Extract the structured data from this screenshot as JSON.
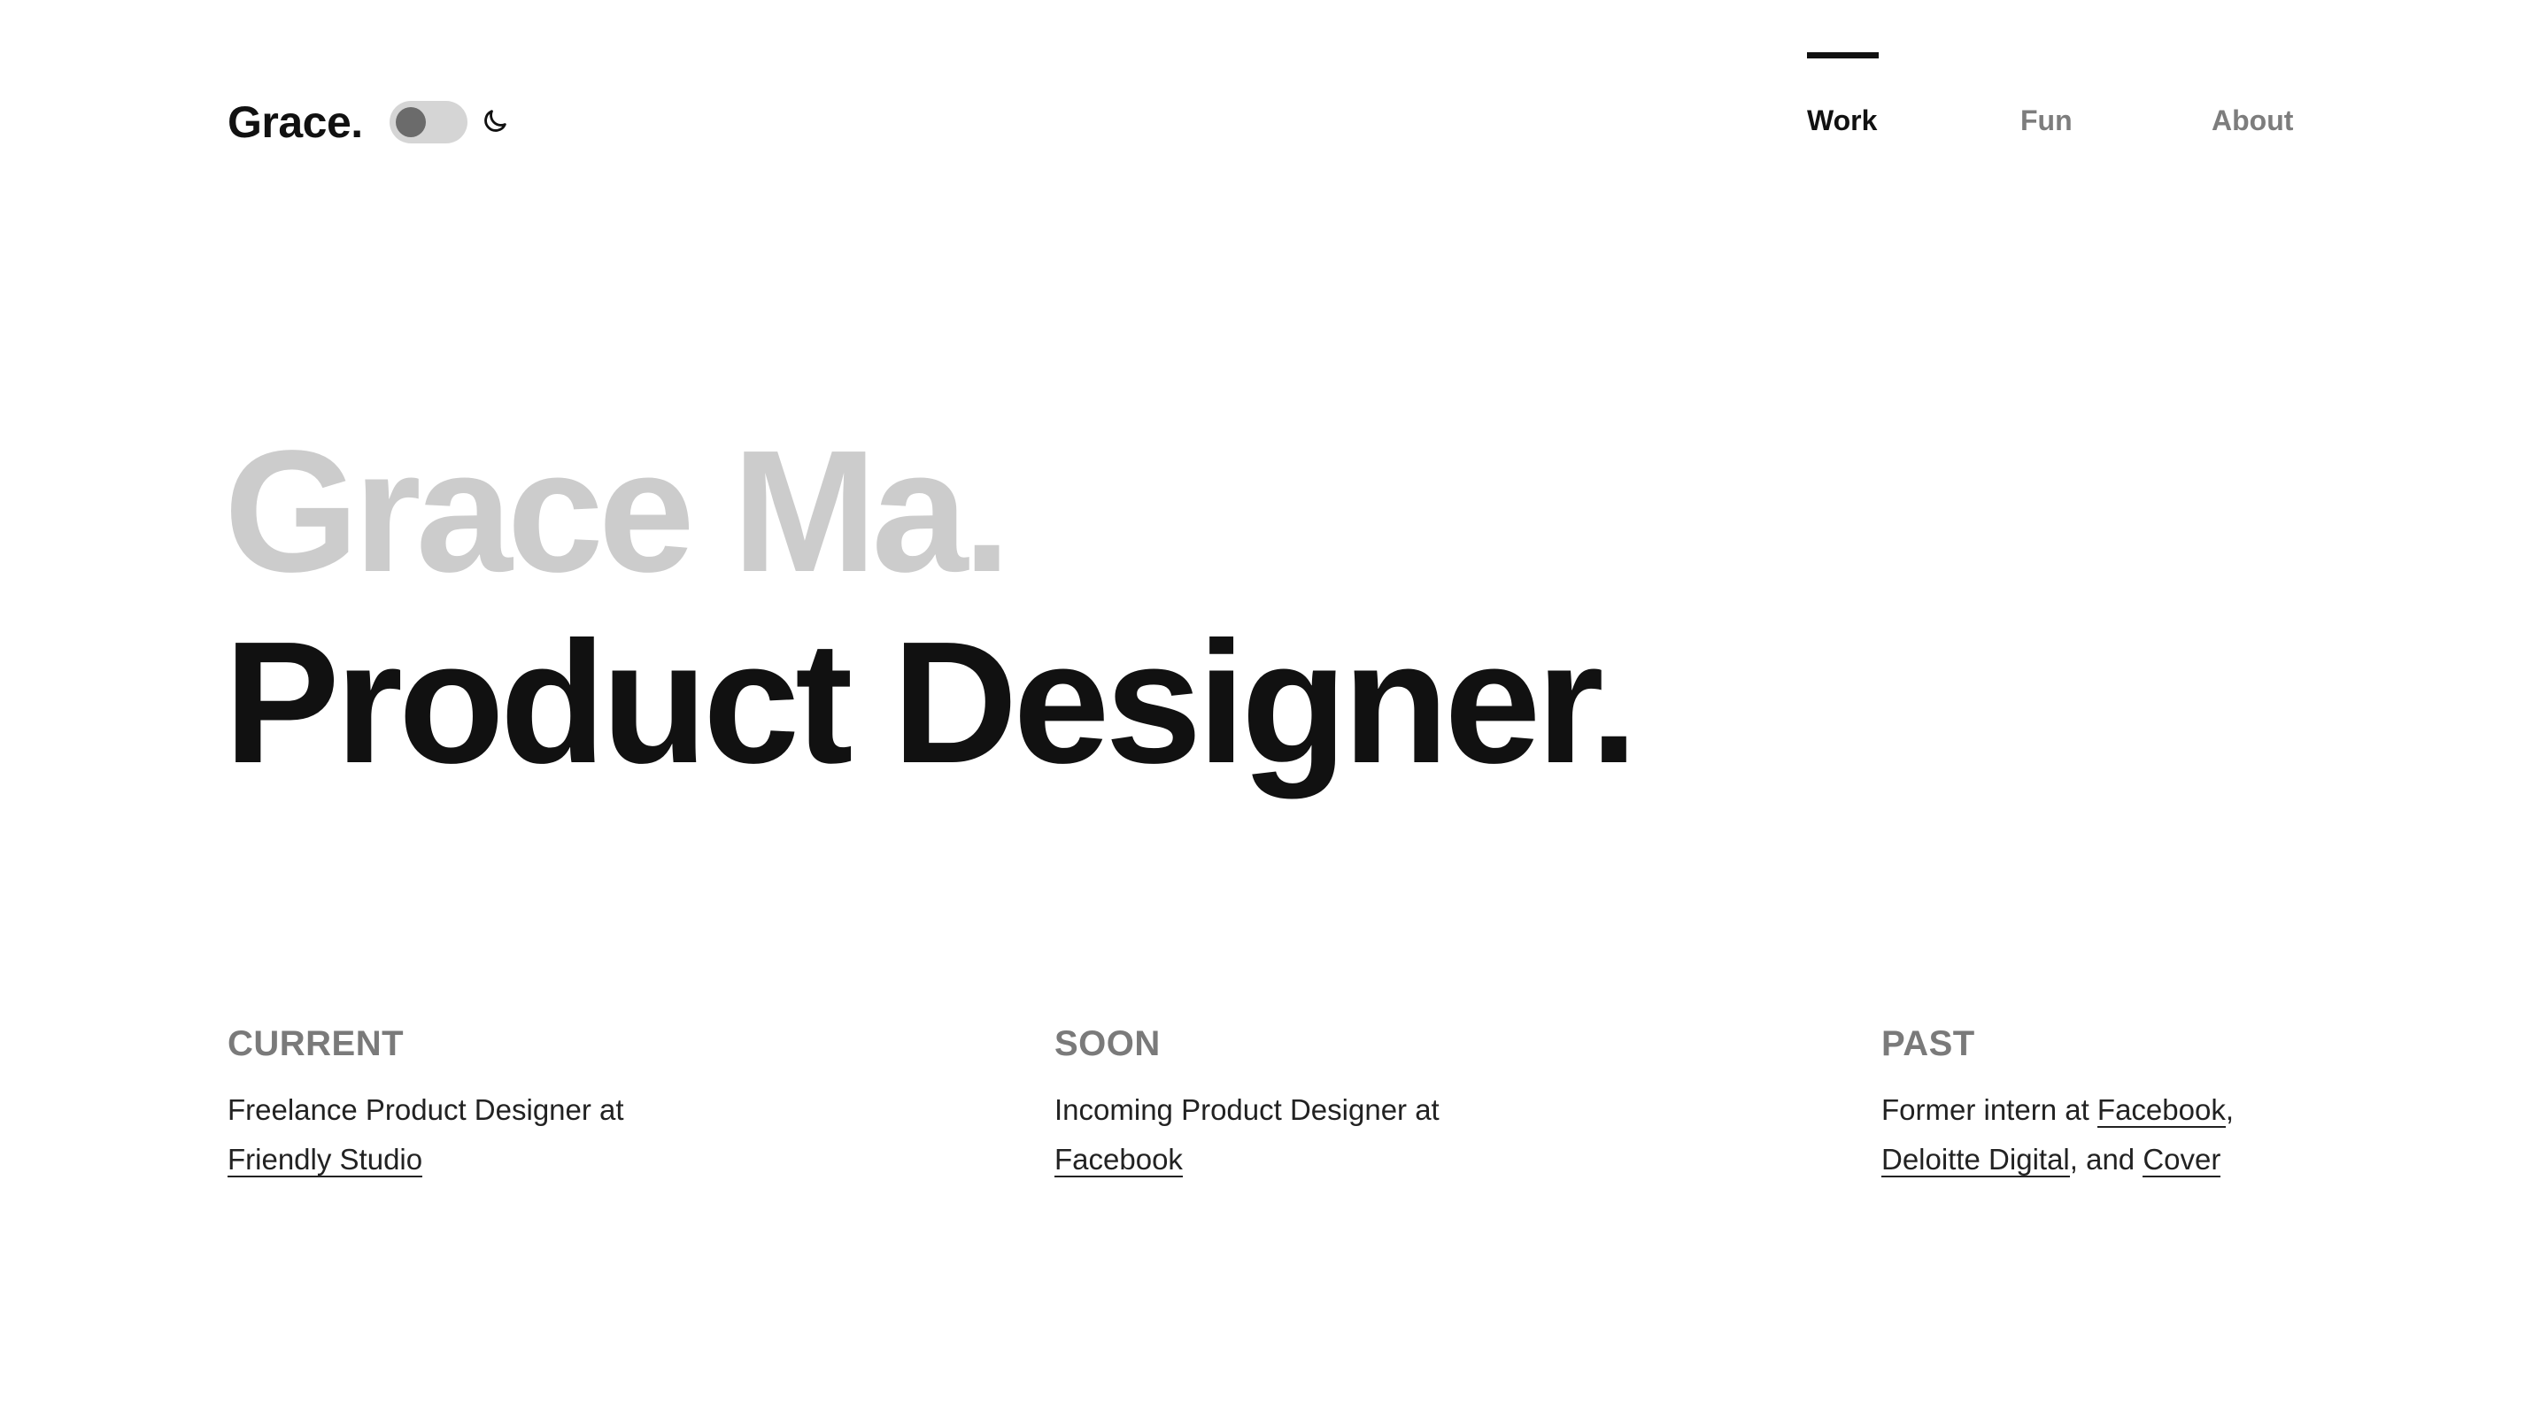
{
  "header": {
    "logo": "Grace.",
    "nav": [
      {
        "label": "Work",
        "active": true
      },
      {
        "label": "Fun",
        "active": false
      },
      {
        "label": "About",
        "active": false
      }
    ]
  },
  "theme_toggle": {
    "icon": "moon-icon",
    "state": "off"
  },
  "hero": {
    "name": "Grace Ma.",
    "role": "Product Designer."
  },
  "columns": {
    "current": {
      "label": "CURRENT",
      "prefix": "Freelance Product Designer at",
      "link1": "Friendly Studio"
    },
    "soon": {
      "label": "SOON",
      "prefix": "Incoming Product Designer at",
      "link1": "Facebook"
    },
    "past": {
      "label": "PAST",
      "prefix": "Former intern at",
      "link1": "Facebook",
      "sep1": ",",
      "link2": "Deloitte Digital",
      "sep2": ", and",
      "link3": "Cover"
    }
  },
  "colors": {
    "text": "#111111",
    "muted": "#7a7a7a",
    "hero_light": "#cccccc",
    "toggle_track": "#d5d5d5",
    "toggle_knob": "#6b6b6b"
  }
}
